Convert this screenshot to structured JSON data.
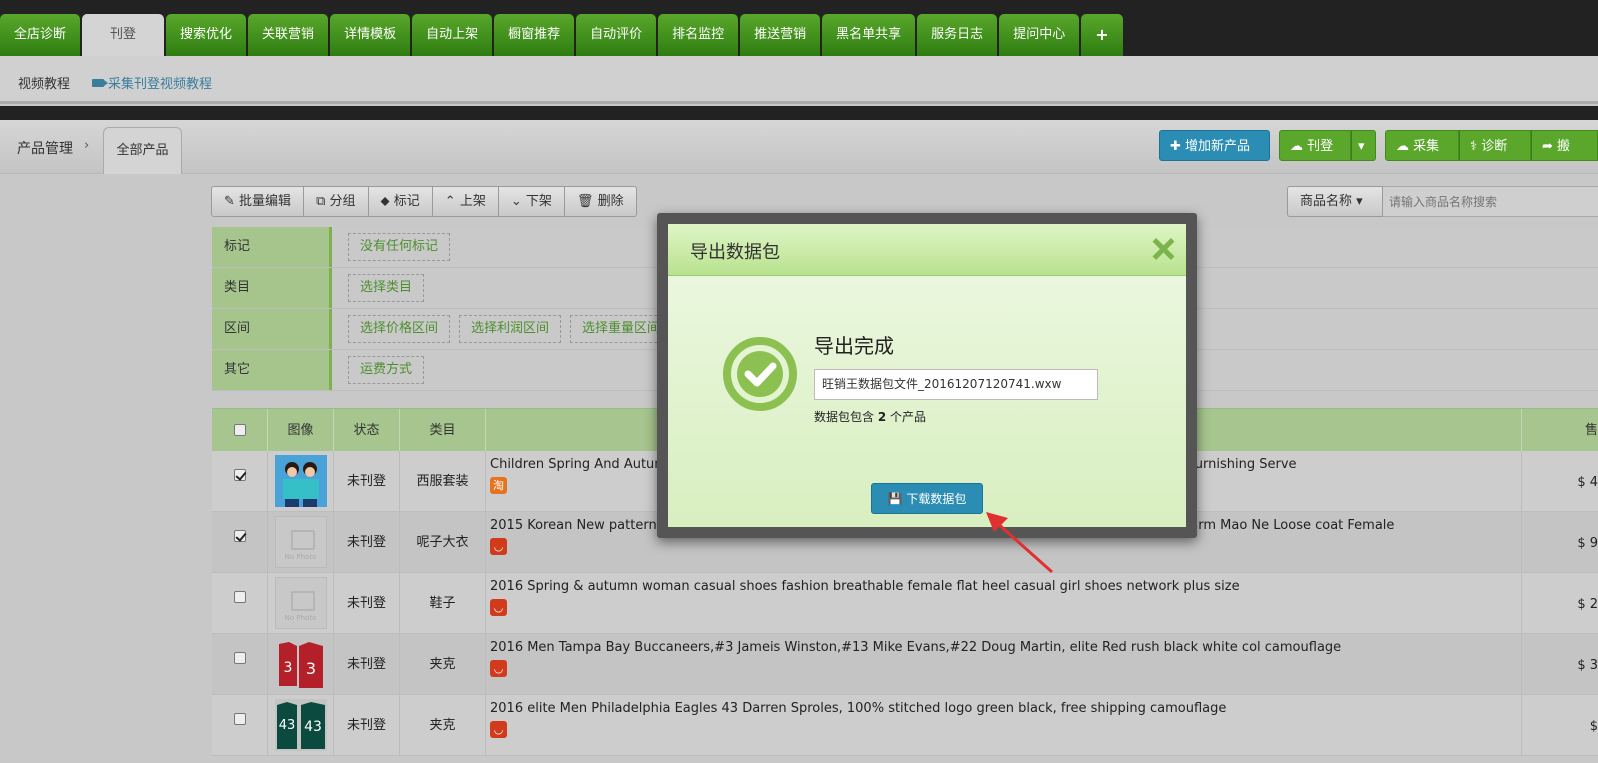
{
  "topnav": {
    "tabs": [
      {
        "label": "全店诊断"
      },
      {
        "label": "刊登",
        "active": true
      },
      {
        "label": "搜索优化"
      },
      {
        "label": "关联营销"
      },
      {
        "label": "详情模板"
      },
      {
        "label": "自动上架"
      },
      {
        "label": "橱窗推荐"
      },
      {
        "label": "自动评价"
      },
      {
        "label": "排名监控"
      },
      {
        "label": "推送营销"
      },
      {
        "label": "黑名单共享"
      },
      {
        "label": "服务日志"
      },
      {
        "label": "提问中心"
      },
      {
        "label": "+"
      }
    ]
  },
  "subbar": {
    "video_tutorial": "视频教程",
    "collect_video": "采集刊登视频教程"
  },
  "breadcrumb": {
    "root": "产品管理",
    "sep": "›",
    "current": "全部产品"
  },
  "actions": {
    "add_product": "增加新产品",
    "publish": "刊登",
    "collect": "采集",
    "diagnose": "诊断",
    "more": "搬"
  },
  "toolbar": {
    "batch_edit": "批量编辑",
    "group": "分组",
    "tag": "标记",
    "on_shelf": "上架",
    "off_shelf": "下架",
    "delete": "删除"
  },
  "search": {
    "field": "商品名称",
    "placeholder": "请输入商品名称搜索"
  },
  "filters": [
    {
      "label": "标记",
      "tags": [
        "没有任何标记"
      ]
    },
    {
      "label": "类目",
      "tags": [
        "选择类目"
      ]
    },
    {
      "label": "区间",
      "tags": [
        "选择价格区间",
        "选择利润区间",
        "选择重量区间"
      ]
    },
    {
      "label": "其它",
      "tags": [
        "运费方式"
      ]
    }
  ],
  "table": {
    "headers": {
      "image": "图像",
      "status": "状态",
      "category": "类目",
      "price": "售"
    },
    "rows": [
      {
        "checked": true,
        "status": "未刊登",
        "category": "西服套装",
        "title": "Children Spring And Autumn",
        "title_right": "Furnishing Serve",
        "shop": "淘",
        "price": "$ 4"
      },
      {
        "checked": true,
        "status": "未刊登",
        "category": "呢子大衣",
        "title": "2015 Korean New pattern Winter clothes Woollen overcoat Slim Temperament Long paragraph Thickened warm Mao Ne Loose coat Female",
        "shop": "ali",
        "price": "$ 9"
      },
      {
        "checked": false,
        "status": "未刊登",
        "category": "鞋子",
        "title": "2016 Spring & autumn woman casual shoes fashion breathable female flat heel casual girl shoes network plus size",
        "shop": "ali",
        "price": "$ 2"
      },
      {
        "checked": false,
        "status": "未刊登",
        "category": "夹克",
        "title": "2016 Men Tampa Bay Buccaneers,#3 Jameis Winston,#13 Mike Evans,#22 Doug Martin, elite Red rush black white col camouflage",
        "shop": "ali",
        "price": "$ 3"
      },
      {
        "checked": false,
        "status": "未刊登",
        "category": "夹克",
        "title": "2016 elite Men Philadelphia Eagles 43 Darren Sproles, 100% stitched logo green black, free shipping camouflage",
        "shop": "ali",
        "price": "$"
      }
    ]
  },
  "no_photo_text": "No Photo",
  "jersey_numbers": [
    "3",
    "3",
    "43",
    "43"
  ],
  "modal": {
    "title": "导出数据包",
    "heading": "导出完成",
    "filename": "旺销王数据包文件_20161207120741.wxw",
    "count_prefix": "数据包包含",
    "count": "2",
    "count_suffix": "个产品",
    "download": "下载数据包"
  },
  "colors": {
    "green": "#5aa72c",
    "blue": "#2b8db4",
    "arrow": "#e03030"
  }
}
